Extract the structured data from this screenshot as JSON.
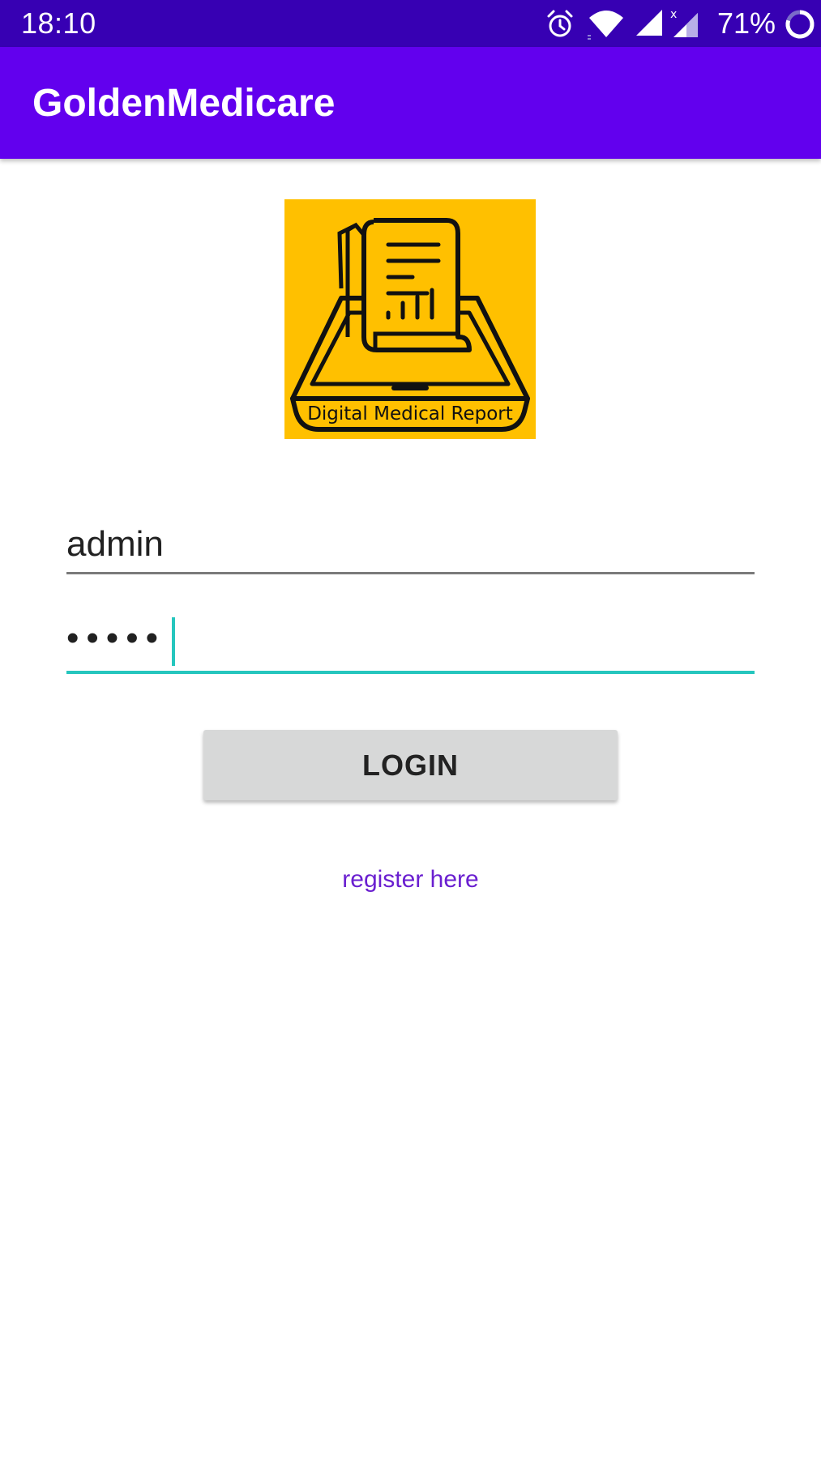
{
  "status_bar": {
    "time": "18:10",
    "battery": "71%",
    "icons": [
      "alarm-icon",
      "wifi-icon",
      "cell-signal-icon",
      "cell-signal-x-icon",
      "battery-ring-icon"
    ]
  },
  "app_bar": {
    "title": "GoldenMedicare"
  },
  "logo": {
    "text": "Digital Medical Report",
    "background_color": "#ffc000"
  },
  "form": {
    "username_value": "admin",
    "password_value": "•••••",
    "login_label": "LOGIN",
    "register_label": "register here"
  },
  "colors": {
    "status_bar": "#3700b3",
    "app_bar": "#6200ee",
    "accent": "#26c6be",
    "link": "#6a1fd0",
    "button": "#d7d8d8"
  }
}
